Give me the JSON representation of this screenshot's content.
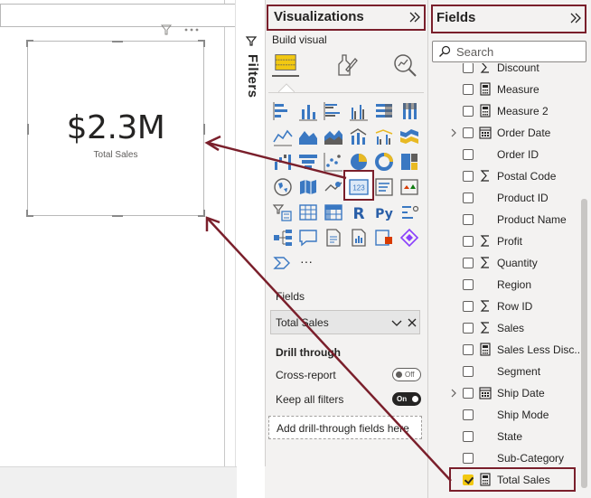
{
  "card": {
    "value": "$2.3M",
    "label": "Total Sales"
  },
  "filters": {
    "label": "Filters"
  },
  "visualizations": {
    "title": "Visualizations",
    "build_visual_label": "Build visual",
    "fields_label": "Fields",
    "field_well": {
      "value": "Total Sales"
    },
    "drill_through": {
      "title": "Drill through",
      "cross_report": {
        "label": "Cross-report",
        "state": "Off"
      },
      "keep_all_filters": {
        "label": "Keep all filters",
        "state": "On"
      },
      "add_fields_placeholder": "Add drill-through fields here"
    },
    "more_label": "···"
  },
  "fields_pane": {
    "title": "Fields",
    "search_placeholder": "Search",
    "items": [
      {
        "name": "Discount",
        "type": "sigma",
        "checked": false,
        "expandable": false
      },
      {
        "name": "Measure",
        "type": "calc",
        "checked": false,
        "expandable": false
      },
      {
        "name": "Measure 2",
        "type": "calc",
        "checked": false,
        "expandable": false
      },
      {
        "name": "Order Date",
        "type": "calendar",
        "checked": false,
        "expandable": true
      },
      {
        "name": "Order ID",
        "type": "none",
        "checked": false,
        "expandable": false
      },
      {
        "name": "Postal Code",
        "type": "sigma",
        "checked": false,
        "expandable": false
      },
      {
        "name": "Product ID",
        "type": "none",
        "checked": false,
        "expandable": false
      },
      {
        "name": "Product Name",
        "type": "none",
        "checked": false,
        "expandable": false
      },
      {
        "name": "Profit",
        "type": "sigma",
        "checked": false,
        "expandable": false
      },
      {
        "name": "Quantity",
        "type": "sigma",
        "checked": false,
        "expandable": false
      },
      {
        "name": "Region",
        "type": "none",
        "checked": false,
        "expandable": false
      },
      {
        "name": "Row ID",
        "type": "sigma",
        "checked": false,
        "expandable": false
      },
      {
        "name": "Sales",
        "type": "sigma",
        "checked": false,
        "expandable": false
      },
      {
        "name": "Sales Less Disc...",
        "type": "calc",
        "checked": false,
        "expandable": false
      },
      {
        "name": "Segment",
        "type": "none",
        "checked": false,
        "expandable": false
      },
      {
        "name": "Ship Date",
        "type": "calendar",
        "checked": false,
        "expandable": true
      },
      {
        "name": "Ship Mode",
        "type": "none",
        "checked": false,
        "expandable": false
      },
      {
        "name": "State",
        "type": "none",
        "checked": false,
        "expandable": false
      },
      {
        "name": "Sub-Category",
        "type": "none",
        "checked": false,
        "expandable": false
      },
      {
        "name": "Total Sales",
        "type": "calc",
        "checked": true,
        "expandable": false
      }
    ]
  },
  "colors": {
    "annotation": "#7a1f2b",
    "checked": "#f2c811",
    "pane_bg": "#f3f2f1",
    "viz_blue": "#3a78c2",
    "viz_yellow": "#e8b923"
  }
}
